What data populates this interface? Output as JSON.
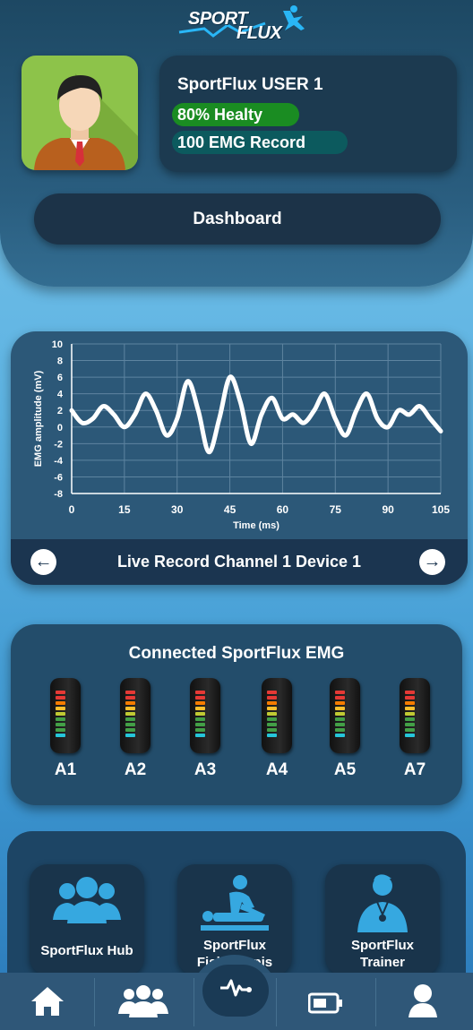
{
  "app": {
    "logo_line1": "SPORT",
    "logo_line2": "FLUX",
    "accent": "#1a8c22",
    "teal": "#0c5a5e"
  },
  "profile": {
    "user_name": "SportFlux USER 1",
    "health_badge": "80% Healty",
    "emg_badge": "100 EMG Record",
    "avatar_icon": "user-avatar-icon"
  },
  "dashboard": {
    "label": "Dashboard"
  },
  "chart_data": {
    "type": "line",
    "title": "",
    "xlabel": "Time (ms)",
    "ylabel": "EMG amplitude (mV)",
    "xlim": [
      0,
      105
    ],
    "ylim": [
      -8,
      10
    ],
    "x_ticks": [
      0,
      15,
      30,
      45,
      60,
      75,
      90,
      105
    ],
    "y_ticks": [
      10,
      8,
      6,
      4,
      2,
      0,
      -2,
      -4,
      -6,
      -8
    ],
    "grid": true,
    "series": [
      {
        "color": "#ffffff",
        "x": [
          0,
          3,
          6,
          9,
          12,
          15,
          18,
          21,
          24,
          27,
          30,
          33,
          36,
          39,
          42,
          45,
          48,
          51,
          54,
          57,
          60,
          63,
          66,
          69,
          72,
          75,
          78,
          81,
          84,
          87,
          90,
          93,
          96,
          99,
          102,
          105
        ],
        "y": [
          2,
          0.5,
          1,
          2.5,
          1.5,
          0,
          1.5,
          4,
          2,
          -1,
          1,
          5.5,
          2,
          -3,
          1,
          6,
          3,
          -2,
          1.5,
          3.5,
          1,
          1.5,
          0.5,
          2,
          4,
          1,
          -1,
          2,
          4,
          1,
          0,
          2,
          1.5,
          2.5,
          1,
          -0.5
        ]
      }
    ]
  },
  "live_record": {
    "label": "Live Record Channel 1 Device 1",
    "prev_icon": "arrow-left-icon",
    "next_icon": "arrow-right-icon"
  },
  "devices": {
    "title": "Connected SportFlux EMG",
    "items": [
      {
        "label": "A1"
      },
      {
        "label": "A2"
      },
      {
        "label": "A3"
      },
      {
        "label": "A4"
      },
      {
        "label": "A5"
      },
      {
        "label": "A7"
      }
    ]
  },
  "menu": {
    "hub": "SportFlux Hub",
    "fisio_line1": "SportFlux",
    "fisio_line2": "Fisioterapis",
    "trainer_line1": "SportFlux",
    "trainer_line2": "Trainer"
  },
  "bottom_nav": {
    "items": [
      "home-icon",
      "group-icon",
      "pulse-icon",
      "battery-icon",
      "person-icon"
    ]
  }
}
